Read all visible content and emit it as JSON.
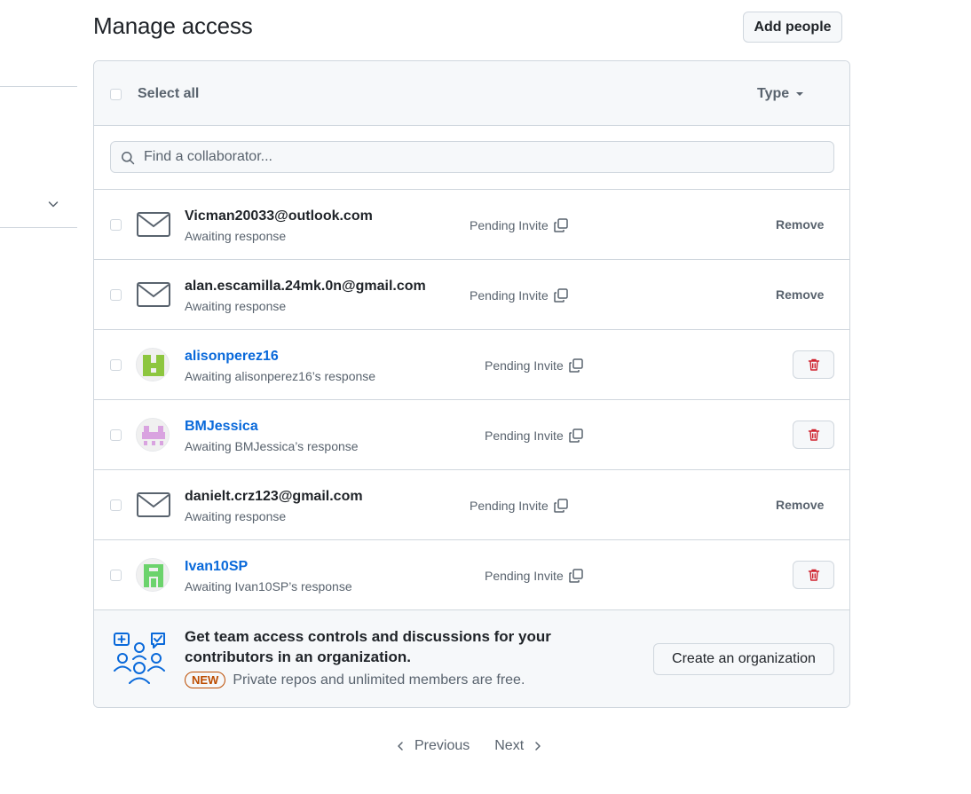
{
  "header": {
    "title": "Manage access",
    "add_people_label": "Add people"
  },
  "toolbar": {
    "select_all_label": "Select all",
    "type_filter_label": "Type"
  },
  "search": {
    "placeholder": "Find a collaborator..."
  },
  "members": [
    {
      "name": "Vicman20033@outlook.com",
      "kind": "email",
      "subtitle": "Awaiting response",
      "status": "Pending Invite",
      "action": "Remove"
    },
    {
      "name": "alan.escamilla.24mk.0n@gmail.com",
      "kind": "email",
      "subtitle": "Awaiting response",
      "status": "Pending Invite",
      "action": "Remove"
    },
    {
      "name": "alisonperez16",
      "kind": "user",
      "subtitle": "Awaiting alisonperez16’s response",
      "status": "Pending Invite",
      "action": "trash-icon",
      "avatar_color": "#8dc63f"
    },
    {
      "name": "BMJessica",
      "kind": "user",
      "subtitle": "Awaiting BMJessica’s response",
      "status": "Pending Invite",
      "action": "trash-icon",
      "avatar_color": "#d9a3e0"
    },
    {
      "name": "danielt.crz123@gmail.com",
      "kind": "email",
      "subtitle": "Awaiting response",
      "status": "Pending Invite",
      "action": "Remove"
    },
    {
      "name": "Ivan10SP",
      "kind": "user",
      "subtitle": "Awaiting Ivan10SP’s response",
      "status": "Pending Invite",
      "action": "trash-icon",
      "avatar_color": "#6cd36c"
    }
  ],
  "promo": {
    "title": "Get team access controls and discussions for your contributors in an organization.",
    "badge": "NEW",
    "subtitle": "Private repos and unlimited members are free.",
    "button_label": "Create an organization"
  },
  "pagination": {
    "previous_label": "Previous",
    "next_label": "Next"
  },
  "colors": {
    "accent": "#0969da",
    "danger": "#cf222e",
    "new_badge": "#bc4c00"
  }
}
